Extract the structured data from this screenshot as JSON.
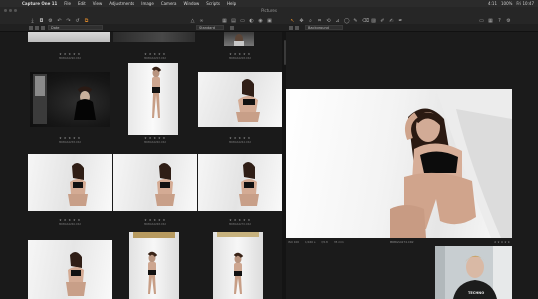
{
  "menubar": {
    "app_name": "Capture One 11",
    "items": [
      "File",
      "Edit",
      "View",
      "Adjustments",
      "Image",
      "Camera",
      "Window",
      "Scripts",
      "Help"
    ],
    "right_items": [
      "4:11",
      "100%",
      "Fri 10:47"
    ]
  },
  "window": {
    "title": "Pictures"
  },
  "subbar": {
    "sort_value": "Date",
    "zoom_value": "Standard",
    "style_value": "Background"
  },
  "browser": {
    "thumbnails": [
      {
        "stars": "★ ★ ★ ★ ★",
        "filename": "MRBGS4290.CR2"
      },
      {
        "stars": "★ ★ ★ ★ ★",
        "filename": "MRBGS4203.CR2"
      },
      {
        "stars": "★ ★ ★ ★ ★",
        "filename": "MRBGS4208.CR2"
      },
      {
        "stars": "★ ★ ★ ★ ★",
        "filename": "MRBGS4258.CR2"
      },
      {
        "stars": "★ ★ ★ ★ ★",
        "filename": "MRBGS4260.CR2"
      },
      {
        "stars": "★ ★ ★ ★ ★",
        "filename": "MRBGS4264.CR2"
      },
      {
        "stars": "★ ★ ★ ★ ★",
        "filename": "MRBGS4266.CR2"
      },
      {
        "stars": "★ ★ ★ ★ ★",
        "filename": "MRBGS4268.CR2"
      },
      {
        "stars": "★ ★ ★ ★ ★",
        "filename": "MRBGS4270.CR2"
      }
    ]
  },
  "viewer": {
    "status_left": [
      "ISO 100",
      "1/160 s",
      "f/2.8",
      "35 mm"
    ],
    "status_center": "MRBGS4274.CR2",
    "status_right": "★ ★ ★ ★ ★"
  },
  "webcam": {
    "shirt_text": "TECHNO"
  }
}
